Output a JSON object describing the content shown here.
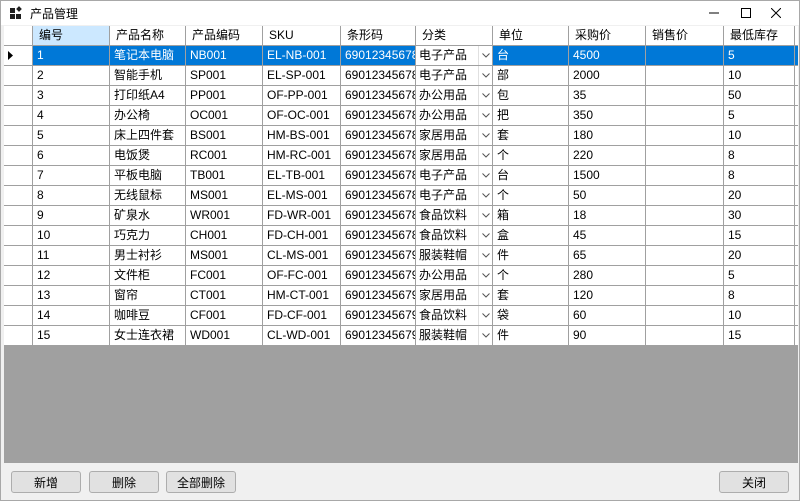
{
  "window": {
    "title": "产品管理"
  },
  "columns": [
    "编号",
    "产品名称",
    "产品编码",
    "SKU",
    "条形码",
    "分类",
    "单位",
    "采购价",
    "销售价",
    "最低库存"
  ],
  "rows": [
    [
      "1",
      "笔记本电脑",
      "NB001",
      "EL-NB-001",
      "69012345678…",
      "电子产品",
      "台",
      "4500",
      "",
      "5"
    ],
    [
      "2",
      "智能手机",
      "SP001",
      "EL-SP-001",
      "69012345678…",
      "电子产品",
      "部",
      "2000",
      "",
      "10"
    ],
    [
      "3",
      "打印纸A4",
      "PP001",
      "OF-PP-001",
      "69012345678…",
      "办公用品",
      "包",
      "35",
      "",
      "50"
    ],
    [
      "4",
      "办公椅",
      "OC001",
      "OF-OC-001",
      "69012345678…",
      "办公用品",
      "把",
      "350",
      "",
      "5"
    ],
    [
      "5",
      "床上四件套",
      "BS001",
      "HM-BS-001",
      "69012345678…",
      "家居用品",
      "套",
      "180",
      "",
      "10"
    ],
    [
      "6",
      "电饭煲",
      "RC001",
      "HM-RC-001",
      "69012345678…",
      "家居用品",
      "个",
      "220",
      "",
      "8"
    ],
    [
      "7",
      "平板电脑",
      "TB001",
      "EL-TB-001",
      "69012345678…",
      "电子产品",
      "台",
      "1500",
      "",
      "8"
    ],
    [
      "8",
      "无线鼠标",
      "MS001",
      "EL-MS-001",
      "69012345678…",
      "电子产品",
      "个",
      "50",
      "",
      "20"
    ],
    [
      "9",
      "矿泉水",
      "WR001",
      "FD-WR-001",
      "69012345678…",
      "食品饮料",
      "箱",
      "18",
      "",
      "30"
    ],
    [
      "10",
      "巧克力",
      "CH001",
      "FD-CH-001",
      "69012345678…",
      "食品饮料",
      "盒",
      "45",
      "",
      "15"
    ],
    [
      "11",
      "男士衬衫",
      "MS001",
      "CL-MS-001",
      "69012345679…",
      "服装鞋帽",
      "件",
      "65",
      "",
      "20"
    ],
    [
      "12",
      "文件柜",
      "FC001",
      "OF-FC-001",
      "69012345679…",
      "办公用品",
      "个",
      "280",
      "",
      "5"
    ],
    [
      "13",
      "窗帘",
      "CT001",
      "HM-CT-001",
      "69012345679…",
      "家居用品",
      "套",
      "120",
      "",
      "8"
    ],
    [
      "14",
      "咖啡豆",
      "CF001",
      "FD-CF-001",
      "69012345679…",
      "食品饮料",
      "袋",
      "60",
      "",
      "10"
    ],
    [
      "15",
      "女士连衣裙",
      "WD001",
      "CL-WD-001",
      "69012345679…",
      "服装鞋帽",
      "件",
      "90",
      "",
      "15"
    ]
  ],
  "buttons": {
    "add": "新增",
    "delete": "删除",
    "delete_all": "全部删除",
    "close": "关闭"
  },
  "icons": {
    "row_pointer": "triangle-right-icon",
    "dropdown": "chevron-down-icon"
  },
  "colors": {
    "selection": "#0078d7",
    "header_selected": "#cce8ff",
    "grid_background": "#a0a0a0"
  }
}
